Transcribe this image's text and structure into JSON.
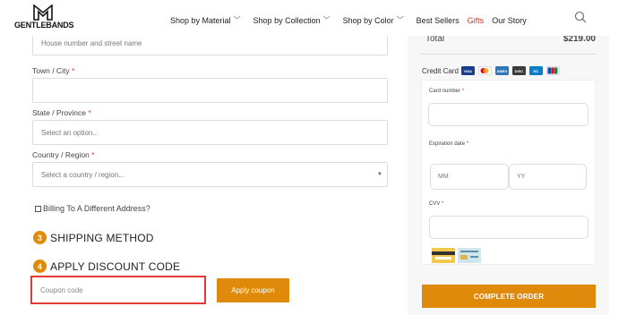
{
  "header": {
    "logo_text": "GENTLEBANDS",
    "nav": [
      {
        "label": "Shop by Material",
        "has_dropdown": true
      },
      {
        "label": "Shop by Collection",
        "has_dropdown": true
      },
      {
        "label": "Shop by Color",
        "has_dropdown": true
      },
      {
        "label": "Best Sellers",
        "has_dropdown": false
      },
      {
        "label": "Gifts",
        "has_dropdown": false
      },
      {
        "label": "Our Story",
        "has_dropdown": false
      }
    ],
    "search_icon": "search-icon"
  },
  "form": {
    "address_placeholder": "House number and street name",
    "town_label": "Town / City ",
    "state_label": "State / Province ",
    "state_placeholder": "Select an option...",
    "country_label": "Country / Region ",
    "country_placeholder": "Select a country / region...",
    "required_mark": "*",
    "billing_label": "Billing To A Different Address?",
    "shipping_step": "3",
    "shipping_title": "SHIPPING METHOD",
    "discount_step": "4",
    "discount_title": "APPLY DISCOUNT CODE",
    "coupon_placeholder": "Coupon code",
    "apply_label": "Apply coupon"
  },
  "summary": {
    "total_label": "Total",
    "total_value": "$219.00",
    "credit_card_label": "Credit Card",
    "card_icons": [
      "visa-icon",
      "mastercard-icon",
      "amex-icon",
      "discover-icon",
      "diners-icon",
      "jcb-icon"
    ],
    "card_number_label": "Card number ",
    "expiration_label": "Expiration date ",
    "mm_placeholder": "MM",
    "yy_placeholder": "YY",
    "cvv_label": "CVV ",
    "required_mark": "*",
    "complete_label": "COMPLETE ORDER"
  },
  "colors": {
    "accent": "#e08a0b",
    "gifts_red": "#c0392b",
    "highlight_red": "#e53935",
    "panel_bg": "#f7f7f7"
  }
}
